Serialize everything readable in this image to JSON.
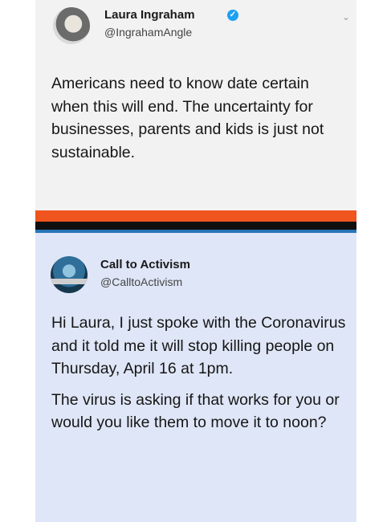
{
  "tweet_top": {
    "name": "Laura Ingraham",
    "handle": "@IngrahamAngle",
    "text": "Americans need to know date certain when this will end.  The uncertainty for businesses, parents and kids is just not sustainable."
  },
  "tweet_bottom": {
    "name": "Call to Activism",
    "handle": "@CalltoActivism",
    "paragraphs": [
      "Hi Laura, I just spoke with the Coronavirus and it told me it will stop killing people on Thursday, April 16 at 1pm.",
      "The virus is asking if that works for you or would you like them to move it to noon?"
    ]
  },
  "colors": {
    "separator_orange": "#f0541f",
    "separator_black": "#0f0f0f",
    "separator_blue": "#2876b8",
    "verified_badge": "#1da1f2"
  },
  "icons": {
    "verified": "verified-badge-icon",
    "menu": "chevron-down-icon"
  }
}
